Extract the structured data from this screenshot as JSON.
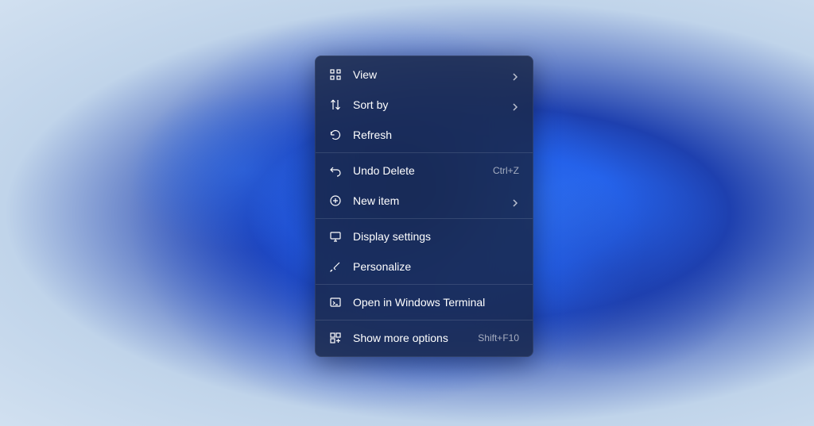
{
  "contextMenu": {
    "items": [
      {
        "label": "View",
        "icon": "grid-icon",
        "hasSubmenu": true
      },
      {
        "label": "Sort by",
        "icon": "sort-icon",
        "hasSubmenu": true
      },
      {
        "label": "Refresh",
        "icon": "refresh-icon"
      },
      {
        "label": "Undo Delete",
        "icon": "undo-icon",
        "shortcut": "Ctrl+Z"
      },
      {
        "label": "New item",
        "icon": "plus-circle-icon",
        "hasSubmenu": true
      },
      {
        "label": "Display settings",
        "icon": "display-icon"
      },
      {
        "label": "Personalize",
        "icon": "brush-icon"
      },
      {
        "label": "Open in Windows Terminal",
        "icon": "terminal-icon"
      },
      {
        "label": "Show more options",
        "icon": "more-icon",
        "shortcut": "Shift+F10"
      }
    ]
  }
}
